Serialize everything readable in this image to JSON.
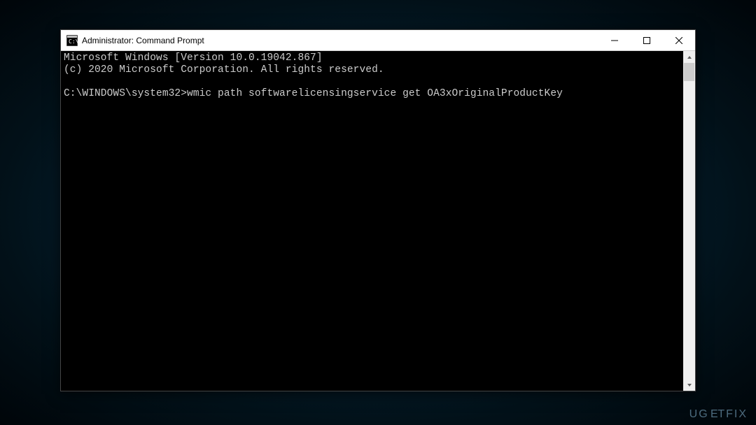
{
  "window": {
    "title": "Administrator: Command Prompt"
  },
  "console": {
    "line1": "Microsoft Windows [Version 10.0.19042.867]",
    "line2": "(c) 2020 Microsoft Corporation. All rights reserved.",
    "blank": "",
    "prompt": "C:\\WINDOWS\\system32>",
    "command": "wmic path softwarelicensingservice get OA3xOriginalProductKey"
  },
  "watermark": {
    "part1": "UG",
    "part2": "Ǝ",
    "part3": "TFIX"
  }
}
